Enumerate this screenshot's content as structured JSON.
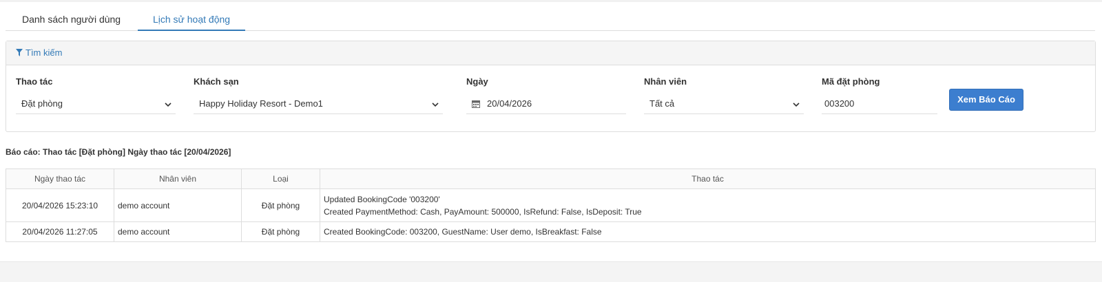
{
  "tabs": [
    {
      "label": "Danh sách người dùng"
    },
    {
      "label": "Lịch sử hoạt động"
    }
  ],
  "filter_panel": {
    "title": "Tìm kiếm",
    "fields": {
      "action": {
        "label": "Thao tác",
        "value": "Đặt phòng"
      },
      "hotel": {
        "label": "Khách sạn",
        "value": "Happy Holiday Resort - Demo1"
      },
      "date": {
        "label": "Ngày",
        "value": "20/04/2026"
      },
      "staff": {
        "label": "Nhân viên",
        "value": "Tất cả"
      },
      "booking_code": {
        "label": "Mã đặt phòng",
        "value": "003200"
      }
    },
    "submit_label": "Xem Báo Cáo"
  },
  "report": {
    "title": "Báo cáo: Thao tác [Đặt phòng] Ngày thao tác [20/04/2026]",
    "columns": [
      "Ngày thao tác",
      "Nhân viên",
      "Loại",
      "Thao tác"
    ],
    "rows": [
      {
        "date": "20/04/2026 15:23:10",
        "staff": "demo account",
        "type": "Đặt phòng",
        "actions": [
          "Updated BookingCode '003200'",
          "Created PaymentMethod: Cash, PayAmount: 500000, IsRefund: False, IsDeposit: True"
        ]
      },
      {
        "date": "20/04/2026 11:27:05",
        "staff": "demo account",
        "type": "Đặt phòng",
        "actions": [
          "Created BookingCode: 003200, GuestName: User demo, IsBreakfast: False"
        ]
      }
    ]
  },
  "icons": {
    "filter": "filter-icon",
    "calendar": "calendar-icon",
    "dropdown": "chevron-down-icon"
  },
  "colors": {
    "accent": "#337ab7",
    "button": "#3c7ecf"
  }
}
